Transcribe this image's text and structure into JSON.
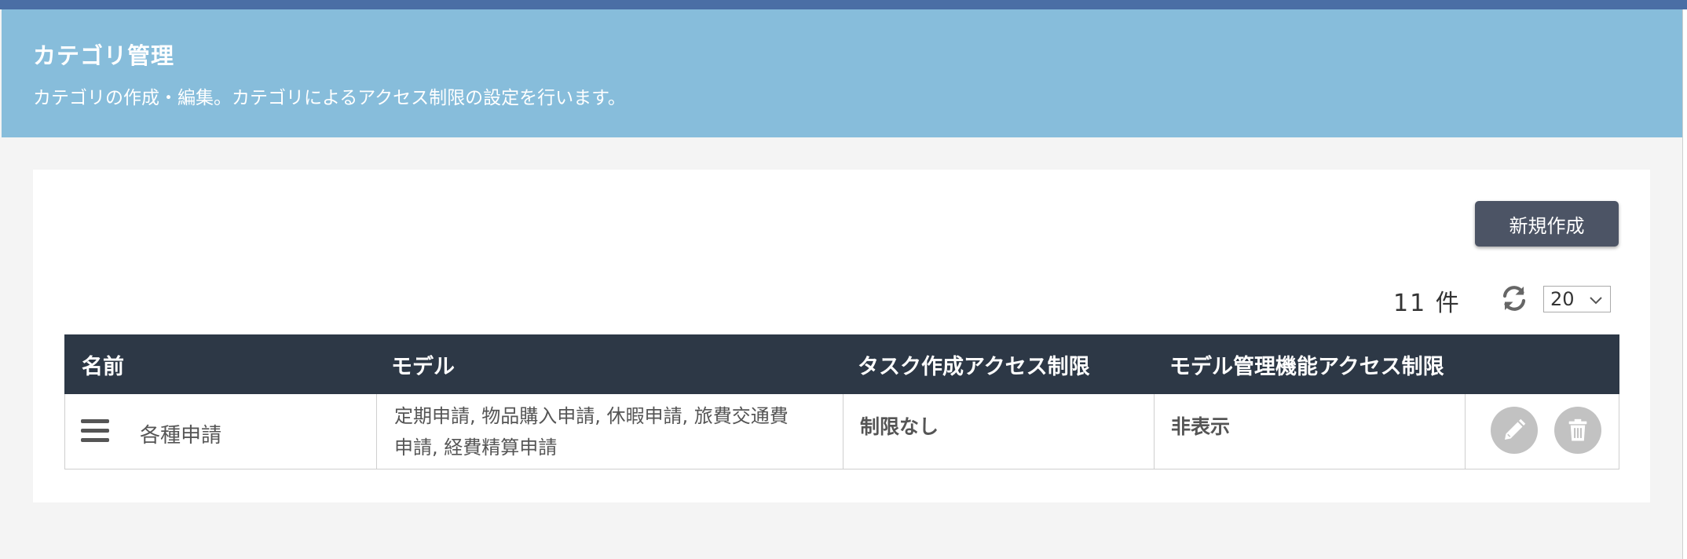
{
  "header": {
    "title": "カテゴリ管理",
    "description": "カテゴリの作成・編集。カテゴリによるアクセス制限の設定を行います。"
  },
  "toolbar": {
    "new_button": "新規作成",
    "count_text": "11 件",
    "per_page": "20",
    "refresh_icon": "refresh-icon"
  },
  "table": {
    "columns": [
      "名前",
      "モデル",
      "タスク作成アクセス制限",
      "モデル管理機能アクセス制限"
    ],
    "rows": [
      {
        "name": "各種申請",
        "models_line1": "定期申請, 物品購入申請, 休暇申請, 旅費交通費",
        "models_line2": "申請, 経費精算申請",
        "task_access": "制限なし",
        "model_admin_access": "非表示"
      }
    ]
  },
  "colors": {
    "top_bar": "#4a6ea5",
    "header_bg": "#87bddb",
    "table_header": "#2d3846",
    "primary_button": "#4c5465",
    "action_circle": "#c2c2c2"
  },
  "icons": [
    "drag-handle-icon",
    "pencil-icon",
    "trash-icon",
    "refresh-icon",
    "chevron-down-icon"
  ]
}
